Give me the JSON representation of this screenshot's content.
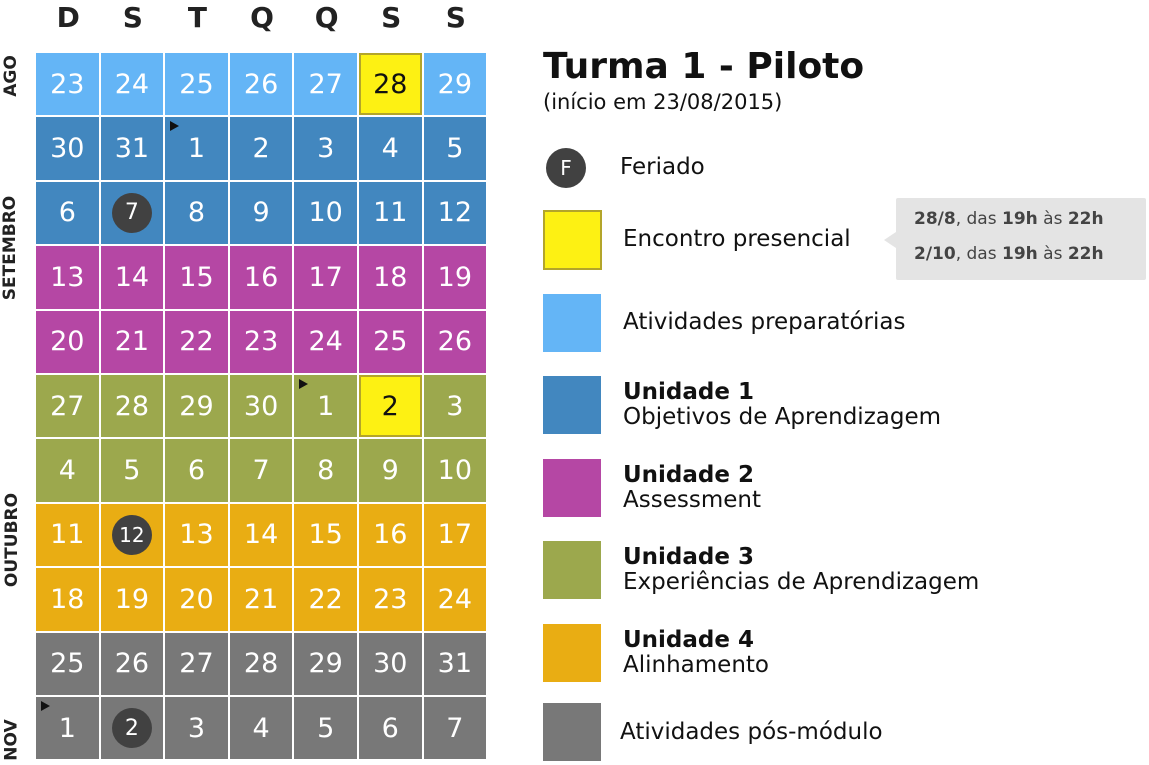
{
  "weekdays": [
    "D",
    "S",
    "T",
    "Q",
    "Q",
    "S",
    "S"
  ],
  "months": {
    "ago": "AGO",
    "setembro": "SETEMBRO",
    "outubro": "OUTUBRO",
    "nov": "NOV"
  },
  "weeks": [
    [
      {
        "d": "23",
        "t": "prep"
      },
      {
        "d": "24",
        "t": "prep"
      },
      {
        "d": "25",
        "t": "prep"
      },
      {
        "d": "26",
        "t": "prep"
      },
      {
        "d": "27",
        "t": "prep"
      },
      {
        "d": "28",
        "t": "presencial"
      },
      {
        "d": "29",
        "t": "prep"
      }
    ],
    [
      {
        "d": "30",
        "t": "u1"
      },
      {
        "d": "31",
        "t": "u1"
      },
      {
        "d": "1",
        "t": "u1",
        "flag": true
      },
      {
        "d": "2",
        "t": "u1"
      },
      {
        "d": "3",
        "t": "u1"
      },
      {
        "d": "4",
        "t": "u1"
      },
      {
        "d": "5",
        "t": "u1"
      }
    ],
    [
      {
        "d": "6",
        "t": "u1"
      },
      {
        "d": "7",
        "t": "u1",
        "holiday": true
      },
      {
        "d": "8",
        "t": "u1"
      },
      {
        "d": "9",
        "t": "u1"
      },
      {
        "d": "10",
        "t": "u1"
      },
      {
        "d": "11",
        "t": "u1"
      },
      {
        "d": "12",
        "t": "u1"
      }
    ],
    [
      {
        "d": "13",
        "t": "u2"
      },
      {
        "d": "14",
        "t": "u2"
      },
      {
        "d": "15",
        "t": "u2"
      },
      {
        "d": "16",
        "t": "u2"
      },
      {
        "d": "17",
        "t": "u2"
      },
      {
        "d": "18",
        "t": "u2"
      },
      {
        "d": "19",
        "t": "u2"
      }
    ],
    [
      {
        "d": "20",
        "t": "u2"
      },
      {
        "d": "21",
        "t": "u2"
      },
      {
        "d": "22",
        "t": "u2"
      },
      {
        "d": "23",
        "t": "u2"
      },
      {
        "d": "24",
        "t": "u2"
      },
      {
        "d": "25",
        "t": "u2"
      },
      {
        "d": "26",
        "t": "u2"
      }
    ],
    [
      {
        "d": "27",
        "t": "u3"
      },
      {
        "d": "28",
        "t": "u3"
      },
      {
        "d": "29",
        "t": "u3"
      },
      {
        "d": "30",
        "t": "u3"
      },
      {
        "d": "1",
        "t": "u3",
        "flag": true
      },
      {
        "d": "2",
        "t": "presencial"
      },
      {
        "d": "3",
        "t": "u3"
      }
    ],
    [
      {
        "d": "4",
        "t": "u3"
      },
      {
        "d": "5",
        "t": "u3"
      },
      {
        "d": "6",
        "t": "u3"
      },
      {
        "d": "7",
        "t": "u3"
      },
      {
        "d": "8",
        "t": "u3"
      },
      {
        "d": "9",
        "t": "u3"
      },
      {
        "d": "10",
        "t": "u3"
      }
    ],
    [
      {
        "d": "11",
        "t": "u4"
      },
      {
        "d": "12",
        "t": "u4",
        "holiday": true
      },
      {
        "d": "13",
        "t": "u4"
      },
      {
        "d": "14",
        "t": "u4"
      },
      {
        "d": "15",
        "t": "u4"
      },
      {
        "d": "16",
        "t": "u4"
      },
      {
        "d": "17",
        "t": "u4"
      }
    ],
    [
      {
        "d": "18",
        "t": "u4"
      },
      {
        "d": "19",
        "t": "u4"
      },
      {
        "d": "20",
        "t": "u4"
      },
      {
        "d": "21",
        "t": "u4"
      },
      {
        "d": "22",
        "t": "u4"
      },
      {
        "d": "23",
        "t": "u4"
      },
      {
        "d": "24",
        "t": "u4"
      }
    ],
    [
      {
        "d": "25",
        "t": "pos"
      },
      {
        "d": "26",
        "t": "pos"
      },
      {
        "d": "27",
        "t": "pos"
      },
      {
        "d": "28",
        "t": "pos"
      },
      {
        "d": "29",
        "t": "pos"
      },
      {
        "d": "30",
        "t": "pos"
      },
      {
        "d": "31",
        "t": "pos"
      }
    ],
    [
      {
        "d": "1",
        "t": "pos",
        "flag": true
      },
      {
        "d": "2",
        "t": "pos",
        "holiday": true
      },
      {
        "d": "3",
        "t": "pos"
      },
      {
        "d": "4",
        "t": "pos"
      },
      {
        "d": "5",
        "t": "pos"
      },
      {
        "d": "6",
        "t": "pos"
      },
      {
        "d": "7",
        "t": "pos"
      }
    ]
  ],
  "title": "Turma 1 - Piloto",
  "subtitle": "(início em 23/08/2015)",
  "legend": {
    "feriado_symbol": "F",
    "feriado": "Feriado",
    "presencial": "Encontro presencial",
    "prep": "Atividades preparatórias",
    "u1_title": "Unidade 1",
    "u1_desc": "Objetivos de Aprendizagem",
    "u2_title": "Unidade 2",
    "u2_desc": "Assessment",
    "u3_title": "Unidade 3",
    "u3_desc": "Experiências de Aprendizagem",
    "u4_title": "Unidade 4",
    "u4_desc": "Alinhamento",
    "pos": "Atividades pós-módulo"
  },
  "callout": [
    {
      "date": "28/8",
      "mid1": ", das ",
      "h1": "19h",
      "mid2": " às ",
      "h2": "22h"
    },
    {
      "date": "2/10",
      "mid1": ", das ",
      "h1": "19h",
      "mid2": " às ",
      "h2": "22h"
    }
  ],
  "colors": {
    "prep": "#64b5f6",
    "u1": "#4287bf",
    "u2": "#b547a4",
    "u3": "#9ca84d",
    "u4": "#e9ad13",
    "pos": "#787878",
    "presencial": "#fdf113",
    "holiday": "#414141"
  }
}
